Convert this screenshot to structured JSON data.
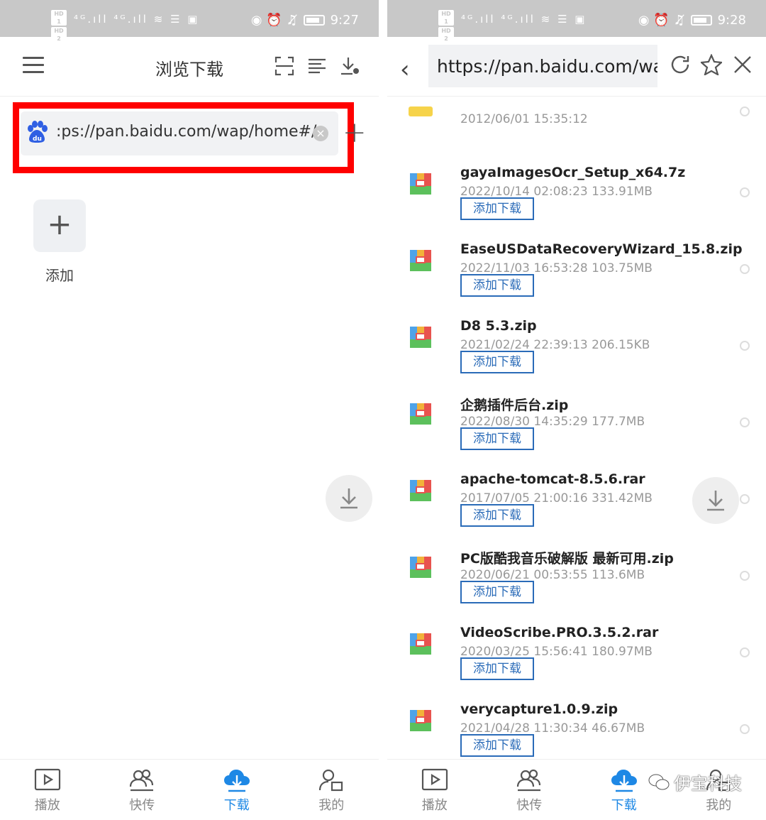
{
  "left": {
    "status": {
      "hd1": "HD 1",
      "hd2": "HD 2",
      "signal": "⁴ᴳ.ıll ⁴ᴳ.ıll ≋ ☰ ▣",
      "right_icons": "◉ ⏰ ♫̸",
      "time": "9:27"
    },
    "header": {
      "title": "浏览下载"
    },
    "address": {
      "text": ":ps://pan.baidu.com/wap/home#/",
      "clear": "×",
      "add": "+"
    },
    "add_tile": {
      "icon": "+",
      "label": "添加"
    },
    "nav": [
      {
        "label": "播放",
        "icon": "play-icon"
      },
      {
        "label": "快传",
        "icon": "users-icon"
      },
      {
        "label": "下载",
        "icon": "cloud-download-icon",
        "active": true
      },
      {
        "label": "我的",
        "icon": "user-icon"
      }
    ]
  },
  "right": {
    "status": {
      "hd1": "HD 1",
      "hd2": "HD 2",
      "signal": "⁴ᴳ.ıll ⁴ᴳ.ıll ≋ ☰ ▣",
      "right_icons": "◉ ⏰ ♫̸",
      "time": "9:28"
    },
    "header": {
      "back": "‹",
      "url": "https://pan.baidu.com/wa"
    },
    "first_row": {
      "meta": "2012/06/01 15:35:12"
    },
    "files": [
      {
        "name": "gayaImagesOcr_Setup_x64.7z",
        "meta": "2022/10/14 02:08:23 133.91MB",
        "button": "添加下载"
      },
      {
        "name": "EaseUSDataRecoveryWizard_15.8.zip",
        "meta": "2022/11/03 16:53:28 103.75MB",
        "button": "添加下载"
      },
      {
        "name": "D8 5.3.zip",
        "meta": "2021/02/24 22:39:13 206.15KB",
        "button": "添加下载"
      },
      {
        "name": "企鹅插件后台.zip",
        "meta": "2022/08/30 14:35:29 177.7MB",
        "button": "添加下载"
      },
      {
        "name": "apache-tomcat-8.5.6.rar",
        "meta": "2017/07/05 21:00:16 331.42MB",
        "button": "添加下载"
      },
      {
        "name": "PC版酷我音乐破解版 最新可用.zip",
        "meta": "2020/06/21 00:53:55 113.6MB",
        "button": "添加下载"
      },
      {
        "name": "VideoScribe.PRO.3.5.2.rar",
        "meta": "2020/03/25 15:56:41 180.97MB",
        "button": "添加下载"
      },
      {
        "name": "verycapture1.0.9.zip",
        "meta": "2021/04/28 11:30:34 46.67MB",
        "button": "添加下载"
      }
    ],
    "nav": [
      {
        "label": "播放",
        "icon": "play-icon"
      },
      {
        "label": "快传",
        "icon": "users-icon"
      },
      {
        "label": "下载",
        "icon": "cloud-download-icon",
        "active": true
      },
      {
        "label": "我的",
        "icon": "user-icon"
      }
    ],
    "watermark": "伊宝科技"
  },
  "colors": {
    "accent": "#1e88e5",
    "highlight": "#ff0000",
    "button_border": "#2a6bb8"
  }
}
